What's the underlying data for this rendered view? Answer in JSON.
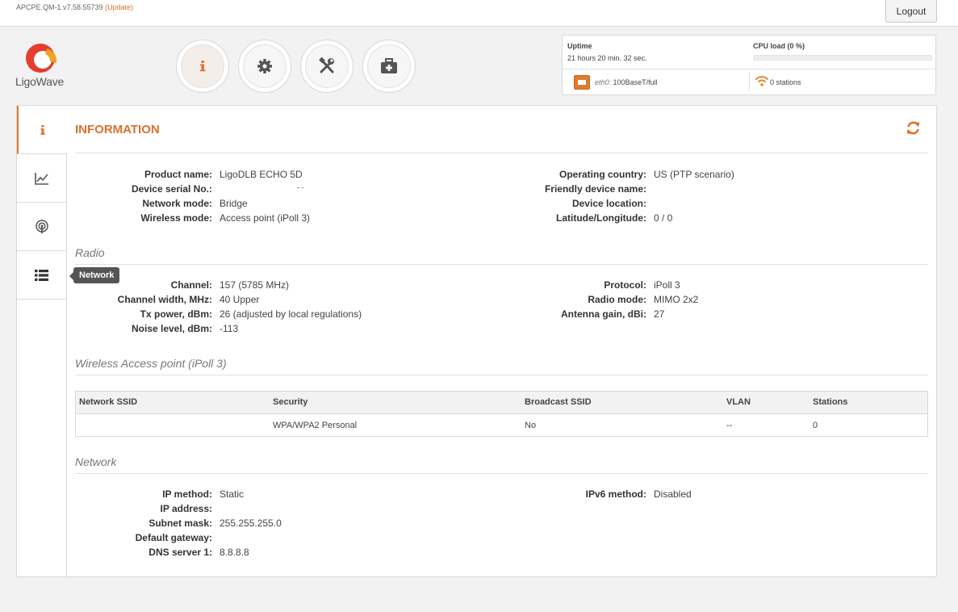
{
  "header": {
    "version": "APCPE.QM-1.v7.58.55739",
    "update_link": "(Update)",
    "logout_label": "Logout"
  },
  "logo": {
    "text": "LigoWave"
  },
  "nav": [
    {
      "name": "info-icon"
    },
    {
      "name": "gear-icon"
    },
    {
      "name": "tools-icon"
    },
    {
      "name": "toolbox-icon"
    }
  ],
  "status": {
    "uptime_label": "Uptime",
    "uptime_value": "21 hours 20 min. 32 sec.",
    "cpu_label": "CPU load (0 %)",
    "cpu_load_percent": 0,
    "eth_name": "eth0:",
    "eth_speed": "100BaseT/full",
    "stations": "0 stations"
  },
  "sidebar": {
    "items": [
      "info-icon",
      "chart-icon",
      "wireless-icon",
      "list-icon"
    ],
    "tooltip": "Network"
  },
  "page": {
    "title": "INFORMATION"
  },
  "info": {
    "left": [
      {
        "label": "Product name:",
        "value": "LigoDLB ECHO 5D"
      },
      {
        "label": "Device serial No.:",
        "value": "- -"
      },
      {
        "label": "Network mode:",
        "value": "Bridge"
      },
      {
        "label": "Wireless mode:",
        "value": "Access point (iPoll 3)"
      }
    ],
    "right": [
      {
        "label": "Operating country:",
        "value": "US (PTP scenario)"
      },
      {
        "label": "Friendly device name:",
        "value": ""
      },
      {
        "label": "Device location:",
        "value": ""
      },
      {
        "label": "Latitude/Longitude:",
        "value": "0 / 0"
      }
    ]
  },
  "radio": {
    "title": "Radio",
    "left": [
      {
        "label": "Channel:",
        "value": "157 (5785 MHz)"
      },
      {
        "label": "Channel width, MHz:",
        "value": "40 Upper"
      },
      {
        "label": "Tx power, dBm:",
        "value": "26 (adjusted by local regulations)"
      },
      {
        "label": "Noise level, dBm:",
        "value": "-113"
      }
    ],
    "right": [
      {
        "label": "Protocol:",
        "value": "iPoll 3"
      },
      {
        "label": "Radio mode:",
        "value": "MIMO 2x2"
      },
      {
        "label": "Antenna gain, dBi:",
        "value": "27"
      }
    ]
  },
  "wireless_ap": {
    "title": "Wireless Access point (iPoll 3)",
    "columns": [
      "Network SSID",
      "Security",
      "Broadcast SSID",
      "VLAN",
      "Stations"
    ],
    "rows": [
      {
        "ssid": "",
        "security": "WPA/WPA2 Personal",
        "broadcast": "No",
        "vlan": "--",
        "stations": "0"
      }
    ]
  },
  "network": {
    "title": "Network",
    "left": [
      {
        "label": "IP method:",
        "value": "Static"
      },
      {
        "label": "IP address:",
        "value": ""
      },
      {
        "label": "Subnet mask:",
        "value": "255.255.255.0"
      },
      {
        "label": "Default gateway:",
        "value": ""
      },
      {
        "label": "DNS server 1:",
        "value": "8.8.8.8"
      }
    ],
    "right": [
      {
        "label": "IPv6 method:",
        "value": "Disabled"
      }
    ]
  },
  "colors": {
    "accent": "#d9722d",
    "background": "#f2f2f2"
  }
}
